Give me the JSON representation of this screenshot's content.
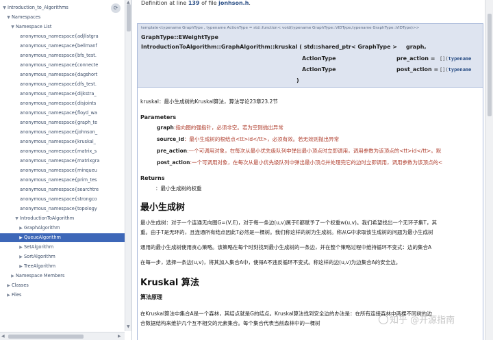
{
  "tree": {
    "sync_icon": "refresh-icon",
    "items": [
      {
        "label": "Introduction_to_Algorithms",
        "arrow": "▼",
        "selected": false
      },
      {
        "label": "Namespaces",
        "arrow": "▼",
        "selected": false
      },
      {
        "label": "Namespace List",
        "arrow": "▼",
        "selected": false
      },
      {
        "label": "anonymous_namespace{adjlistgra",
        "arrow": "",
        "selected": false
      },
      {
        "label": "anonymous_namespace{bellmanf",
        "arrow": "",
        "selected": false
      },
      {
        "label": "anonymous_namespace{bfs_test.",
        "arrow": "",
        "selected": false
      },
      {
        "label": "anonymous_namespace{connecte",
        "arrow": "",
        "selected": false
      },
      {
        "label": "anonymous_namespace{dagshort",
        "arrow": "",
        "selected": false
      },
      {
        "label": "anonymous_namespace{dfs_test.",
        "arrow": "",
        "selected": false
      },
      {
        "label": "anonymous_namespace{dijkstra_",
        "arrow": "",
        "selected": false
      },
      {
        "label": "anonymous_namespace{disjoints",
        "arrow": "",
        "selected": false
      },
      {
        "label": "anonymous_namespace{floyd_wa",
        "arrow": "",
        "selected": false
      },
      {
        "label": "anonymous_namespace{graph_te",
        "arrow": "",
        "selected": false
      },
      {
        "label": "anonymous_namespace{johnson_",
        "arrow": "",
        "selected": false
      },
      {
        "label": "anonymous_namespace{kruskal_",
        "arrow": "",
        "selected": false
      },
      {
        "label": "anonymous_namespace{matrix_s",
        "arrow": "",
        "selected": false
      },
      {
        "label": "anonymous_namespace{matrixgra",
        "arrow": "",
        "selected": false
      },
      {
        "label": "anonymous_namespace{minqueu",
        "arrow": "",
        "selected": false
      },
      {
        "label": "anonymous_namespace{prim_tes",
        "arrow": "",
        "selected": false
      },
      {
        "label": "anonymous_namespace{searchtre",
        "arrow": "",
        "selected": false
      },
      {
        "label": "anonymous_namespace{strongco",
        "arrow": "",
        "selected": false
      },
      {
        "label": "anonymous_namespace{topology",
        "arrow": "",
        "selected": false
      },
      {
        "label": "IntroductionToAlgorithm",
        "arrow": "▼",
        "selected": false
      },
      {
        "label": "GraphAlgorithm",
        "arrow": "▶",
        "selected": false
      },
      {
        "label": "QueueAlgorithm",
        "arrow": "▶",
        "selected": true
      },
      {
        "label": "SetAlgorithm",
        "arrow": "▶",
        "selected": false
      },
      {
        "label": "SortAlgorithm",
        "arrow": "▶",
        "selected": false
      },
      {
        "label": "TreeAlgorithm",
        "arrow": "▶",
        "selected": false
      },
      {
        "label": "Namespace Members",
        "arrow": "▶",
        "selected": false
      },
      {
        "label": "Classes",
        "arrow": "▶",
        "selected": false
      },
      {
        "label": "Files",
        "arrow": "▶",
        "selected": false
      }
    ],
    "scroll_left": "◀",
    "scroll_right": "▶",
    "scroll_up": "▲",
    "scroll_down": "▼"
  },
  "content": {
    "definition_prefix": "Definition at line ",
    "definition_line": "139",
    "definition_mid": " of file ",
    "definition_file": "jonhson.h",
    "definition_suffix": ".",
    "template_line": "template<typename GraphType , typename ActionType = std::function< void(typename GraphType::VIDType,typename GraphType::VIDType)>>",
    "return_type": "GraphType::EWeightType",
    "signature_start": "IntroductionToAlgorithm::GraphAlgorithm::kruskal ( std::shared_ptr< GraphType >",
    "param1_name": "graph,",
    "param2_type": "ActionType",
    "param2_name": "pre_action =",
    "param2_default_pre": "[](",
    "param2_default_kw": "typename",
    "param3_type": "ActionType",
    "param3_name": "post_action =",
    "param3_default_pre": "[](",
    "param3_default_kw": "typename",
    "close_paren": ")",
    "brief": "kruskal：最小生成树的Kruskal算法，算法导论23章23.2节",
    "params_heading": "Parameters",
    "params": [
      {
        "name": "graph",
        "desc": ":指向图的强指针，必须非空。若为空则抛出异常"
      },
      {
        "name": "source_id",
        "desc": "：最小生成树的根结点<tt>id</tt>，必须有效。若无效则抛出异常"
      },
      {
        "name": "pre_action",
        "desc": ":一个可调用对象，在每次从最小优先级队列中弹出最小顶点时立即调用，调用参数为该顶点的<tt>id</tt>。默"
      },
      {
        "name": "post_action",
        "desc": ":一个可调用对象，在每次从最小优先级队列中弹出最小顶点并处理完它的边时立即调用，调用参数为该顶点的<"
      }
    ],
    "returns_heading": "Returns",
    "returns_text": "：最小生成树的权重",
    "section1_title": "最小生成树",
    "section1_para1_l1": "最小生成树：对于一个连通无向图G=(V,E)，对于每一条边(u,v)属于E都赋予了一个权重w(u,v)。我们希望找出一个无环子集T，其",
    "section1_para1_l2": "重。由于T是无环的，且连通所有结点因此T必然是一棵树。我们称这样的树为生成树。称从G中求取该生成树的问题为最小生成树",
    "section1_para2": "通用的最小生成树使用贪心策略。该策略在每个时刻找到最小生成树的一条边，并在整个策略过程中维持循环不变式：边的集合A",
    "section1_para3": "在每一步，选择一条边(u,v)，将其加入集合A中，使得A不违反循环不变式。称这样的边(u,v)为边集合A的安全边。",
    "section2_title": "Kruskal 算法",
    "section2_sub": "算法原理",
    "section2_para_l1": "在Kruskal算法中集合A是一个森林，其结点就是G的结点。Kruskal算法找到安全边的办法是：在所有连接森林中两棵不同树的边",
    "section2_para_l2": "合数据结构来维护几个互不相交的元素集合。每个集合代表当前森林中的一棵树"
  },
  "watermark": "知乎 @开源指南"
}
